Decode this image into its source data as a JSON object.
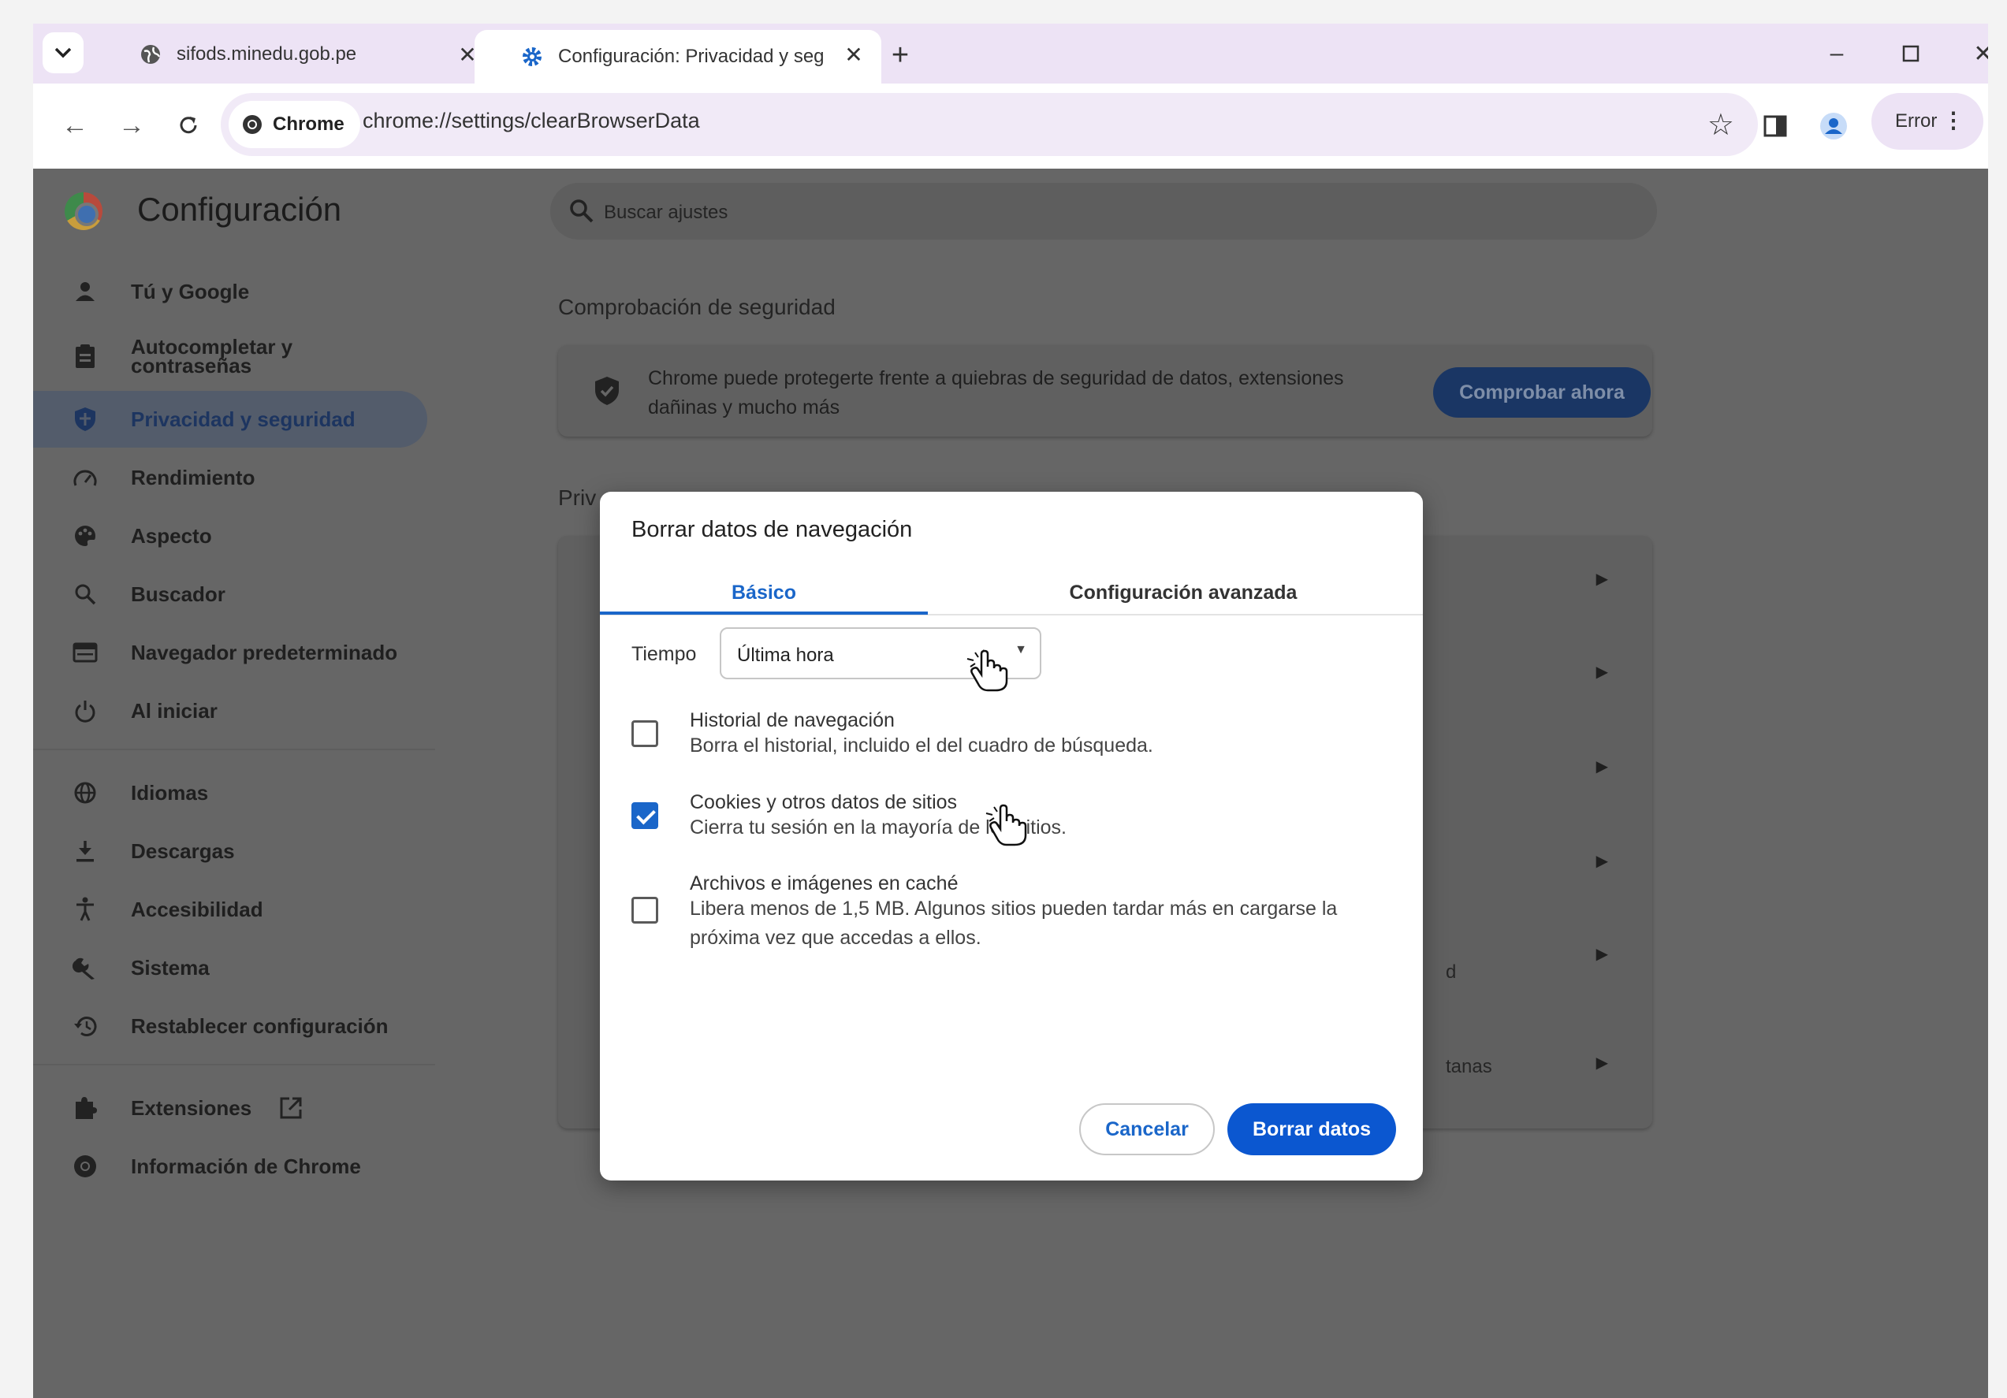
{
  "browser": {
    "tabs": [
      {
        "title": "sifods.minedu.gob.pe"
      },
      {
        "title": "Configuración: Privacidad y seg"
      }
    ],
    "chip_label": "Chrome",
    "url": "chrome://settings/clearBrowserData",
    "profile_error_label": "Error"
  },
  "settings": {
    "title": "Configuración",
    "search_placeholder": "Buscar ajustes",
    "sidebar": {
      "items": [
        {
          "label": "Tú y Google",
          "icon": "person-icon"
        },
        {
          "label": "Autocompletar y contraseñas",
          "icon": "clipboard-icon"
        },
        {
          "label": "Privacidad y seguridad",
          "icon": "shield-icon",
          "active": true
        },
        {
          "label": "Rendimiento",
          "icon": "speedometer-icon"
        },
        {
          "label": "Aspecto",
          "icon": "palette-icon"
        },
        {
          "label": "Buscador",
          "icon": "search-icon"
        },
        {
          "label": "Navegador predeterminado",
          "icon": "browser-icon"
        },
        {
          "label": "Al iniciar",
          "icon": "power-icon"
        },
        {
          "label": "Idiomas",
          "icon": "globe-icon"
        },
        {
          "label": "Descargas",
          "icon": "download-icon"
        },
        {
          "label": "Accesibilidad",
          "icon": "accessibility-icon"
        },
        {
          "label": "Sistema",
          "icon": "wrench-icon"
        },
        {
          "label": "Restablecer configuración",
          "icon": "history-icon"
        },
        {
          "label": "Extensiones",
          "icon": "puzzle-icon"
        },
        {
          "label": "Información de Chrome",
          "icon": "chrome-icon"
        }
      ]
    },
    "safety": {
      "heading": "Comprobación de seguridad",
      "text": "Chrome puede protegerte frente a quiebras de seguridad de datos, extensiones dañinas y mucho más",
      "button": "Comprobar ahora"
    },
    "privacy_heading_partial": "Priv",
    "partial_texts": [
      "d",
      "tanas"
    ]
  },
  "dialog": {
    "title": "Borrar datos de navegación",
    "tabs": {
      "basic": "Básico",
      "advanced": "Configuración avanzada"
    },
    "time_label": "Tiempo",
    "time_value": "Última hora",
    "options": [
      {
        "title": "Historial de navegación",
        "desc": "Borra el historial, incluido el del cuadro de búsqueda.",
        "checked": false
      },
      {
        "title": "Cookies y otros datos de sitios",
        "desc": "Cierra tu sesión en la mayoría de los sitios.",
        "checked": true
      },
      {
        "title": "Archivos e imágenes en caché",
        "desc": "Libera menos de 1,5 MB. Algunos sitios pueden tardar más en cargarse la próxima vez que accedas a ellos.",
        "checked": false
      }
    ],
    "cancel": "Cancelar",
    "confirm": "Borrar datos"
  },
  "colors": {
    "accent": "#0b57d0",
    "tab_strip": "#ede3f5",
    "overlay": "#666666"
  }
}
